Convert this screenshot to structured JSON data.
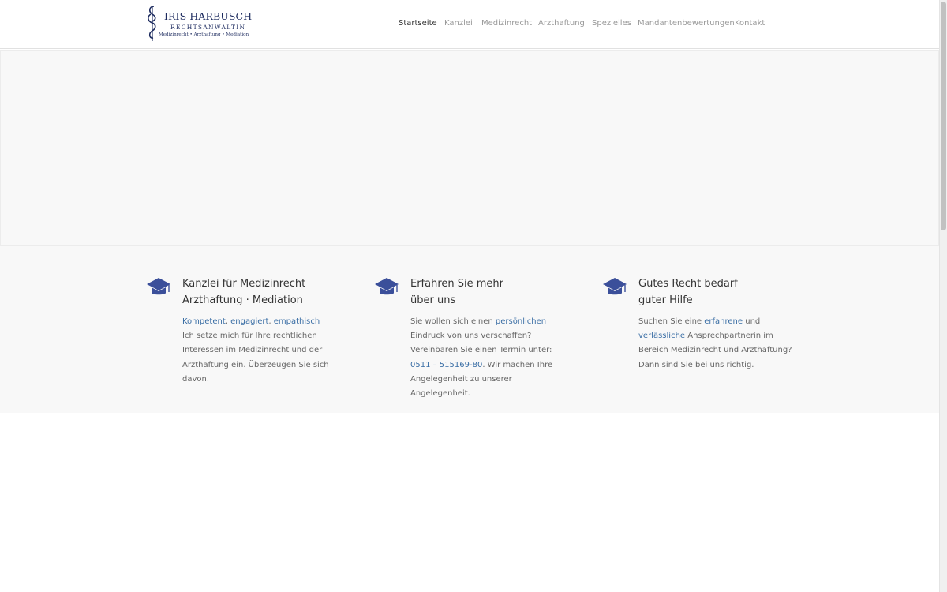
{
  "header": {
    "logo": {
      "name": "IRIS HARBUSCH",
      "subtitle": "RECHTSANWÄLTIN",
      "tagline": "Medizinrecht • Arzthaftung • Mediation"
    },
    "nav": [
      {
        "label": "Startseite",
        "active": true
      },
      {
        "label": "Kanzlei",
        "active": false
      },
      {
        "label": "Medizinrecht",
        "active": false
      },
      {
        "label": "Arzthaftung",
        "active": false
      },
      {
        "label": "Spezielles",
        "active": false
      },
      {
        "label": "Mandantenbewertungen",
        "active": false
      },
      {
        "label": "Kontakt",
        "active": false
      }
    ]
  },
  "features": [
    {
      "icon": "graduation-cap-icon",
      "title_line1": "Kanzlei für Medizinrecht",
      "title_line2": "Arzthaftung · Mediation",
      "body": {
        "hl1": "Kompetent",
        "sep1": ", ",
        "hl2": "engagiert",
        "sep2": ", ",
        "hl3": "empathisch",
        "text": "Ich setze mich für Ihre rechtlichen Interessen im Medizinrecht und der Arzthaftung ein. Überzeugen Sie sich davon."
      }
    },
    {
      "icon": "graduation-cap-icon",
      "title_line1": "Erfahren Sie mehr",
      "title_line2": "über uns",
      "body": {
        "t1": "Sie wollen sich einen ",
        "hl1": "persönlichen",
        "t2": " Eindruck von uns verschaffen? Vereinbaren Sie einen Termin unter: ",
        "hl2": "0511 – 515169-80",
        "t3": ". Wir machen Ihre Angelegenheit zu unserer Angelegenheit."
      }
    },
    {
      "icon": "graduation-cap-icon",
      "title_line1": "Gutes Recht bedarf",
      "title_line2": "guter Hilfe",
      "body": {
        "t1": "Suchen Sie eine ",
        "hl1": "erfahrene",
        "t2": " und ",
        "hl2": "verlässliche",
        "t3": " Ansprechpartnerin im Bereich Medizinrecht und Arzthaftung? Dann sind Sie bei uns richtig."
      }
    }
  ],
  "colors": {
    "accent": "#3a6ea5",
    "icon": "#3b4f9a",
    "logo": "#1c2a5e",
    "section_bg": "#f8f8f8"
  }
}
